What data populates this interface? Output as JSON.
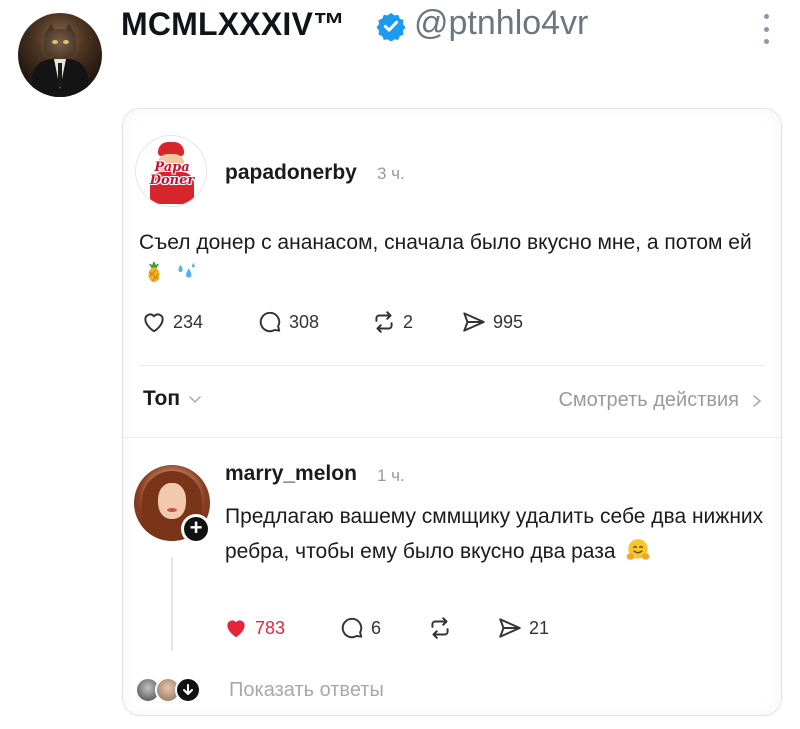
{
  "tweet": {
    "display_name": "MCMLXXXIV™",
    "handle": "@ptnhlo4vr",
    "avatar_icon": "cat-in-suit-avatar",
    "verified_icon": "verified-badge-icon",
    "more_icon": "more-vertical-icon",
    "colors": {
      "verified": "#1d9bf0",
      "muted": "#6b7680"
    }
  },
  "post": {
    "username": "papadonerby",
    "time": "3 ч.",
    "avatar_logo": "Papa Doner",
    "text": "Съел донер с ананасом, сначала было вкусно мне, а потом ей",
    "emojis": [
      "pineapple",
      "sweat-droplets"
    ],
    "actions": {
      "likes": "234",
      "comments": "308",
      "reposts": "2",
      "shares": "995"
    }
  },
  "sort": {
    "label": "Топ",
    "view_actions": "Смотреть действия"
  },
  "reply": {
    "username": "marry_melon",
    "time": "1 ч.",
    "text": "Предлагаю вашему сммщику удалить себе два нижних ребра, чтобы ему было вкусно два раза",
    "emoji": "smiling-face-with-open-hands",
    "actions": {
      "likes": "783",
      "comments": "6",
      "reposts": "",
      "shares": "21"
    },
    "like_color": "#e8243a"
  },
  "show_replies": "Показать ответы"
}
